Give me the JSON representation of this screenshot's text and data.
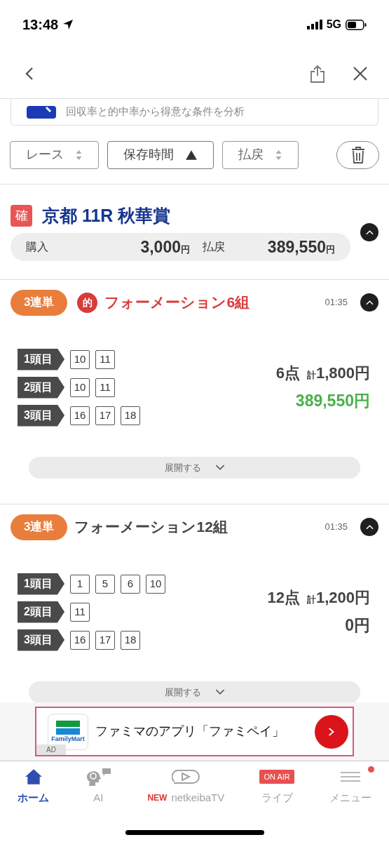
{
  "status_bar": {
    "time": "13:48",
    "network": "5G"
  },
  "banner": {
    "text": "回収率と的中率から得意な条件を分析"
  },
  "sort_buttons": [
    {
      "label": "レース",
      "kind": "both",
      "selected": false
    },
    {
      "label": "保存時間",
      "kind": "asc",
      "selected": true
    },
    {
      "label": "払戻",
      "kind": "both",
      "selected": false
    }
  ],
  "race": {
    "badge": "確",
    "title": "京都 11R 秋華賞",
    "purchase_label": "購入",
    "purchase": "3,000",
    "payout_label": "払戻",
    "payout": "389,550",
    "purchase_unit": "円",
    "payout_unit": "円",
    "expanded": true
  },
  "bets": [
    {
      "type": "3連単",
      "hit": true,
      "hit_mark": "的",
      "title": "フォーメーション6組",
      "time": "01:35",
      "expanded": true,
      "legs": [
        {
          "label": "1頭目",
          "numbers": [
            "10",
            "11"
          ]
        },
        {
          "label": "2頭目",
          "numbers": [
            "10",
            "11"
          ]
        },
        {
          "label": "3頭目",
          "numbers": [
            "16",
            "17",
            "18"
          ]
        }
      ],
      "points": "6点",
      "total_prefix": "計",
      "total": "1,800円",
      "return": "389,550円",
      "expand_label": "展開する"
    },
    {
      "type": "3連単",
      "hit": false,
      "title": "フォーメーション12組",
      "time": "01:35",
      "expanded": true,
      "legs": [
        {
          "label": "1頭目",
          "numbers": [
            "1",
            "5",
            "6",
            "10"
          ]
        },
        {
          "label": "2頭目",
          "numbers": [
            "11"
          ]
        },
        {
          "label": "3頭目",
          "numbers": [
            "16",
            "17",
            "18"
          ]
        }
      ],
      "points": "12点",
      "total_prefix": "計",
      "total": "1,200円",
      "return": "0円",
      "expand_label": "展開する"
    }
  ],
  "ad": {
    "logo_text": "FamilyMart",
    "text": "ファミマのアプリ「ファミペイ」",
    "label": "AD"
  },
  "tab_bar": [
    {
      "label": "ホーム",
      "kind": "home",
      "selected": true
    },
    {
      "label": "AI",
      "kind": "ai",
      "selected": false
    },
    {
      "label": "netkeibaTV",
      "kind": "tv",
      "badge": "NEW",
      "selected": false
    },
    {
      "label": "ライブ",
      "kind": "live",
      "badge": "ON AIR",
      "selected": false
    },
    {
      "label": "メニュー",
      "kind": "menu",
      "notification": true,
      "selected": false
    }
  ]
}
